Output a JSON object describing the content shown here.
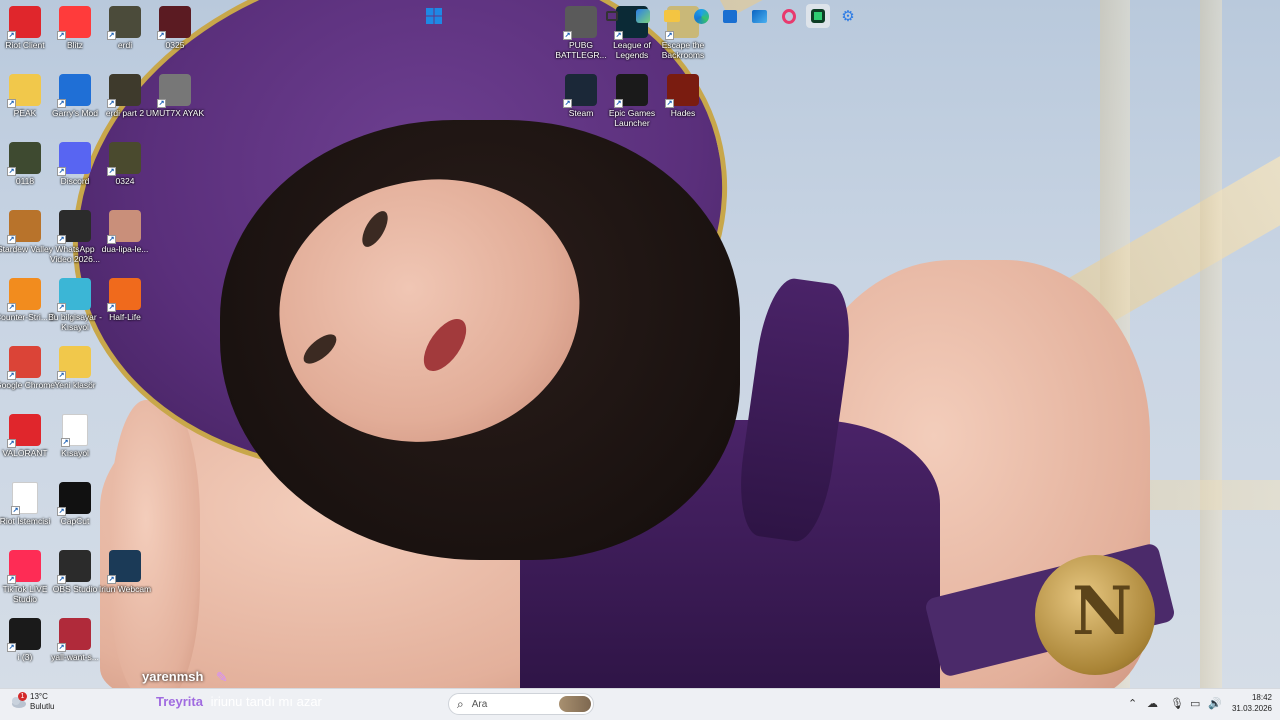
{
  "desktop_icons": [
    {
      "label": "Riot Client",
      "icon": "riot-client-icon",
      "color": "#e0262c"
    },
    {
      "label": "Blitz",
      "icon": "blitz-icon",
      "color": "#ff3b3b"
    },
    {
      "label": "erdi",
      "icon": "video-thumb-icon",
      "color": "#4b4b3a"
    },
    {
      "label": "0325",
      "icon": "video-thumb-icon",
      "color": "#5b1b22"
    },
    {
      "label": "PEAK",
      "icon": "folder-icon",
      "color": "#f1c84b"
    },
    {
      "label": "Garry's Mod",
      "icon": "garrys-mod-icon",
      "color": "#1f6fd6"
    },
    {
      "label": "erdi part 2",
      "icon": "video-thumb-icon",
      "color": "#3e3a2c"
    },
    {
      "label": "UMUT7X AYAK",
      "icon": "image-thumb-icon",
      "color": "#777777"
    },
    {
      "label": "0118",
      "icon": "video-thumb-icon",
      "color": "#3e4a30"
    },
    {
      "label": "Discord",
      "icon": "discord-icon",
      "color": "#5865f2"
    },
    {
      "label": "0324",
      "icon": "video-thumb-icon",
      "color": "#4a4a2e"
    },
    {
      "label": "Stardew Valley",
      "icon": "stardew-valley-icon",
      "color": "#b8732b"
    },
    {
      "label": "WhatsApp Video 2026...",
      "icon": "video-thumb-icon",
      "color": "#2b2b2b"
    },
    {
      "label": "dua-lipa-le...",
      "icon": "image-thumb-icon",
      "color": "#c98f7a"
    },
    {
      "label": "Counter-Stri... 2",
      "icon": "counter-strike-icon",
      "color": "#f28c1e"
    },
    {
      "label": "Bu bilgisayar - Kısayol",
      "icon": "this-pc-icon",
      "color": "#3bb6d6"
    },
    {
      "label": "Half-Life",
      "icon": "half-life-icon",
      "color": "#f06a1c"
    },
    {
      "label": "Google Chrome",
      "icon": "chrome-icon",
      "color": "#db4437"
    },
    {
      "label": "Yeni klasör",
      "icon": "folder-icon",
      "color": "#f1c84b"
    },
    {
      "label": "VALORANT",
      "icon": "valorant-icon",
      "color": "#e0262c"
    },
    {
      "label": "Kısayol",
      "icon": "blank-file-icon",
      "color": "#ffffff"
    },
    {
      "label": "Riot İstemcisi",
      "icon": "blank-file-icon",
      "color": "#ffffff"
    },
    {
      "label": "CapCut",
      "icon": "capcut-icon",
      "color": "#111111"
    },
    {
      "label": "TikTok LIVE Studio",
      "icon": "tiktok-live-icon",
      "color": "#fe2c55"
    },
    {
      "label": "OBS Studio",
      "icon": "obs-icon",
      "color": "#2b2b2b"
    },
    {
      "label": "Iriun Webcam",
      "icon": "iriun-webcam-icon",
      "color": "#1b3a57"
    },
    {
      "label": "i (3)",
      "icon": "image-thumb-icon",
      "color": "#1a1a1a"
    },
    {
      "label": "yall-want-s...",
      "icon": "image-thumb-icon",
      "color": "#b02a3a"
    },
    {
      "label": "PUBG BATTLEGR...",
      "icon": "pubg-icon",
      "color": "#5a5a5a"
    },
    {
      "label": "League of Legends",
      "icon": "league-of-legends-icon",
      "color": "#0b2a36"
    },
    {
      "label": "Escape the Backrooms",
      "icon": "escape-backrooms-icon",
      "color": "#c9b878"
    },
    {
      "label": "Steam",
      "icon": "steam-icon",
      "color": "#1b2838"
    },
    {
      "label": "Epic Games Launcher",
      "icon": "epic-games-icon",
      "color": "#1a1a1a"
    },
    {
      "label": "Hades",
      "icon": "hades-icon",
      "color": "#7a1c10"
    }
  ],
  "overlay": {
    "username": "yarenmsh"
  },
  "taskbar": {
    "weather_temp": "13°C",
    "weather_desc": "Bulutlu",
    "weather_alert_count": "1",
    "caption_highlight": "Treyrita",
    "caption_rest": "iriunu tandı mı azar",
    "search_placeholder": "Ara",
    "clock_time": "18:42",
    "clock_date": "31.03.2026"
  }
}
